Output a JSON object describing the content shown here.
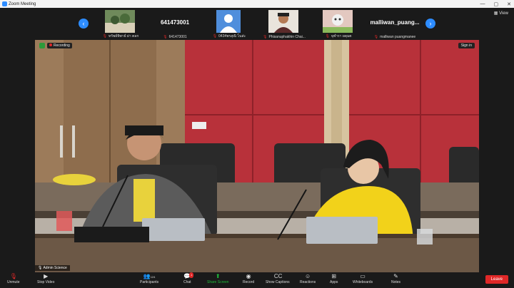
{
  "titlebar": {
    "title": "Zoom Meeting",
    "controls": [
      "—",
      "▢",
      "✕"
    ]
  },
  "strip": {
    "prev_arrow": "‹",
    "next_arrow": "›",
    "view_label": "View",
    "participants": [
      {
        "name": "ทรัพย์ทิพาย์ ผ่า ตลก",
        "tile": "image"
      },
      {
        "name": "641473001",
        "display": "641473001",
        "tile": "text"
      },
      {
        "name": "0434พรสุณิ โนส่ะ",
        "tile": "avatar"
      },
      {
        "name": "Phisanuphakhin Chai...",
        "tile": "image"
      },
      {
        "name": "จุฬารา ผดุมต",
        "tile": "image"
      },
      {
        "name": "malliwan puangmanee",
        "display": "malliwan_puang...",
        "tile": "text"
      }
    ]
  },
  "main": {
    "recording_label": "Recording",
    "signin_label": "Sign in",
    "speaker_label": "Admin Science"
  },
  "toolbar": {
    "items": [
      {
        "label": "Unmute",
        "icon": "microphone-muted-icon"
      },
      {
        "label": "Stop Video",
        "icon": "video-camera-icon"
      },
      {
        "label": "Participants",
        "icon": "participants-icon",
        "count": "124"
      },
      {
        "label": "Chat",
        "icon": "chat-icon",
        "badge": "1"
      },
      {
        "label": "Share Screen",
        "icon": "share-screen-icon"
      },
      {
        "label": "Record",
        "icon": "record-icon"
      },
      {
        "label": "Show Captions",
        "icon": "captions-icon"
      },
      {
        "label": "Reactions",
        "icon": "reactions-icon"
      },
      {
        "label": "Apps",
        "icon": "apps-icon"
      },
      {
        "label": "Whiteboards",
        "icon": "whiteboard-icon"
      },
      {
        "label": "Notes",
        "icon": "notes-icon"
      }
    ],
    "leave_label": "Leave"
  },
  "colors": {
    "accent": "#2d8cff",
    "leave": "#e02828",
    "share_green": "#1fbd3a",
    "background": "#1a1a1a"
  }
}
